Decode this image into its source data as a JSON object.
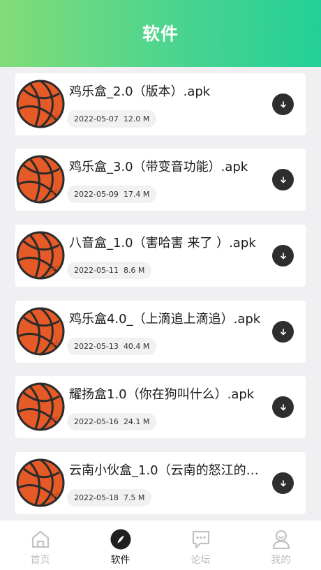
{
  "header": {
    "title": "软件"
  },
  "files": [
    {
      "name": "鸡乐盒_2.0（版本）.apk",
      "date": "2022-05-07",
      "size": "12.0 M"
    },
    {
      "name": "鸡乐盒_3.0（带变音功能）.apk",
      "date": "2022-05-09",
      "size": "17.4 M"
    },
    {
      "name": "八音盒_1.0（害哈害 来了 ）.apk",
      "date": "2022-05-11",
      "size": "8.6 M"
    },
    {
      "name": "鸡乐盒4.0_（上滴追上滴追）.apk",
      "date": "2022-05-13",
      "size": "40.4 M"
    },
    {
      "name": "耀扬盒1.0（你在狗叫什么）.apk",
      "date": "2022-05-16",
      "size": "24.1 M"
    },
    {
      "name": "云南小伙盒_1.0（云南的怒江的…",
      "date": "2022-05-18",
      "size": "7.5 M"
    }
  ],
  "icons": {
    "file_thumb": "basketball-icon",
    "download": "download-icon"
  },
  "tabs": [
    {
      "label": "首页",
      "icon": "home-icon",
      "active": false
    },
    {
      "label": "软件",
      "icon": "compass-icon",
      "active": true
    },
    {
      "label": "论坛",
      "icon": "chat-icon",
      "active": false
    },
    {
      "label": "我的",
      "icon": "user-icon",
      "active": false
    }
  ],
  "colors": {
    "header_gradient_start": "#82dc78",
    "header_gradient_end": "#24cf97",
    "basketball": "#e55a26",
    "active_tab": "#222222",
    "inactive_tab": "#bdbdbd"
  }
}
